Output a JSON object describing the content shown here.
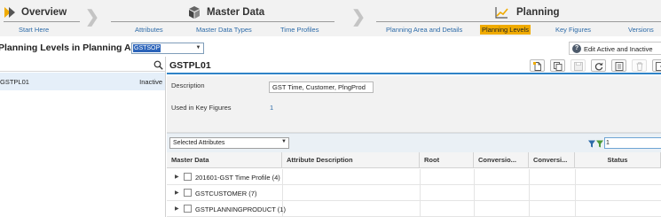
{
  "nav": {
    "overview": {
      "title": "Overview",
      "sub": "Start Here"
    },
    "master_data": {
      "title": "Master Data",
      "subs": [
        "Attributes",
        "Master Data Types",
        "Time Profiles"
      ]
    },
    "planning": {
      "title": "Planning",
      "subs": [
        "Planning Area and Details",
        "Planning Levels",
        "Key Figures",
        "Versions"
      ],
      "active": "Planning Levels"
    }
  },
  "toolbar": {
    "title": "Planning Levels in Planning Area",
    "planning_area": "GSTSOP",
    "edit_label": "Edit Active and Inactive"
  },
  "left": {
    "items": [
      {
        "name": "GSTPL01",
        "status": "Inactive"
      }
    ]
  },
  "detail": {
    "title": "GSTPL01",
    "description_label": "Description",
    "description_value": "GST Time, Customer, PlngProd",
    "used_in_label": "Used in Key Figures",
    "used_in_value": "1"
  },
  "filter": {
    "selected_attributes": "Selected Attributes",
    "filter_value": "1"
  },
  "table": {
    "columns": [
      "Master Data",
      "Attribute Description",
      "Root",
      "Conversio...",
      "Conversi...",
      "Status"
    ],
    "rows": [
      {
        "label": "201601-GST Time Profile (4)"
      },
      {
        "label": "GSTCUSTOMER (7)"
      },
      {
        "label": "GSTPLANNINGPRODUCT (1)"
      }
    ]
  },
  "colors": {
    "accent": "#2f83c7",
    "highlight": "#f0ab00",
    "link": "#2d6ba8",
    "selected_row": "#e5eff9"
  }
}
